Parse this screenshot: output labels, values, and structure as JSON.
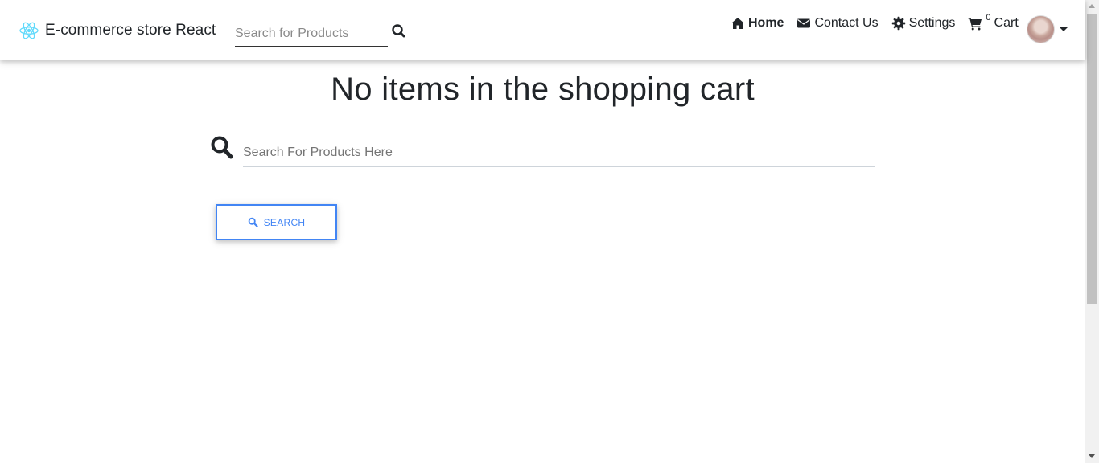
{
  "navbar": {
    "brand_name": "E-commerce store React",
    "search_placeholder": "Search for Products",
    "links": {
      "home": "Home",
      "contact": "Contact Us",
      "settings": "Settings",
      "cart": "Cart",
      "cart_count": "0"
    }
  },
  "main": {
    "title": "No items in the shopping cart",
    "search_placeholder": "Search For Products Here",
    "search_button": "SEARCH"
  },
  "colors": {
    "accent": "#4285f4",
    "react_logo": "#61dafb",
    "text": "#212529"
  },
  "icons": {
    "brand": "react-logo-icon",
    "nav_search": "search-icon",
    "home": "home-icon",
    "contact": "envelope-icon",
    "settings": "gear-icon",
    "cart": "shopping-cart-icon",
    "avatar_menu": "caret-down-icon",
    "big_search": "search-icon"
  }
}
